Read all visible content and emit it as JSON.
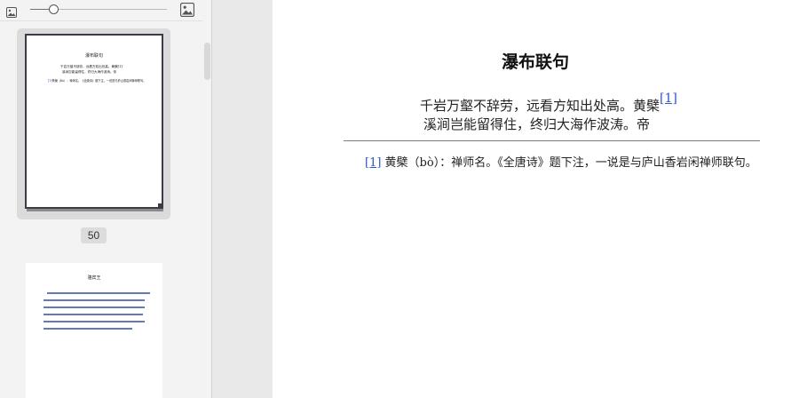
{
  "sidebar": {
    "zoom_level": 0.17,
    "thumbnails": [
      {
        "title": "瀑布联句",
        "lines": [
          "千岩万壑不辞劳，远看方知出处高。黄檗[1]",
          "溪涧岂能留得住，终归大海作波涛。帝"
        ],
        "note_ref": "[1]",
        "note": "黄檗（bò）：禅师名。《全唐诗》题下注，一说是与庐山香岩闲禅师联句。",
        "selected": true
      },
      {
        "title": "骆宾王",
        "selected": false
      }
    ],
    "current_page_number": "50"
  },
  "document": {
    "title": "瀑布联句",
    "poem_line_1": "千岩万壑不辞劳，远看方知出处高。黄檗",
    "poem_line_1_ref": "[1]",
    "poem_line_2": "溪涧岂能留得住，终归大海作波涛。帝",
    "footnote_ref": "[1]",
    "footnote_text": " 黄檗（bò）：禅师名。《全唐诗》题下注，一说是与庐山香岩闲禅师联句。"
  },
  "colors": {
    "link": "#2a55c9",
    "sidebar_bg": "#f3f3f3",
    "page_bg": "#ffffff",
    "gutter_bg": "#e9e9e9"
  }
}
